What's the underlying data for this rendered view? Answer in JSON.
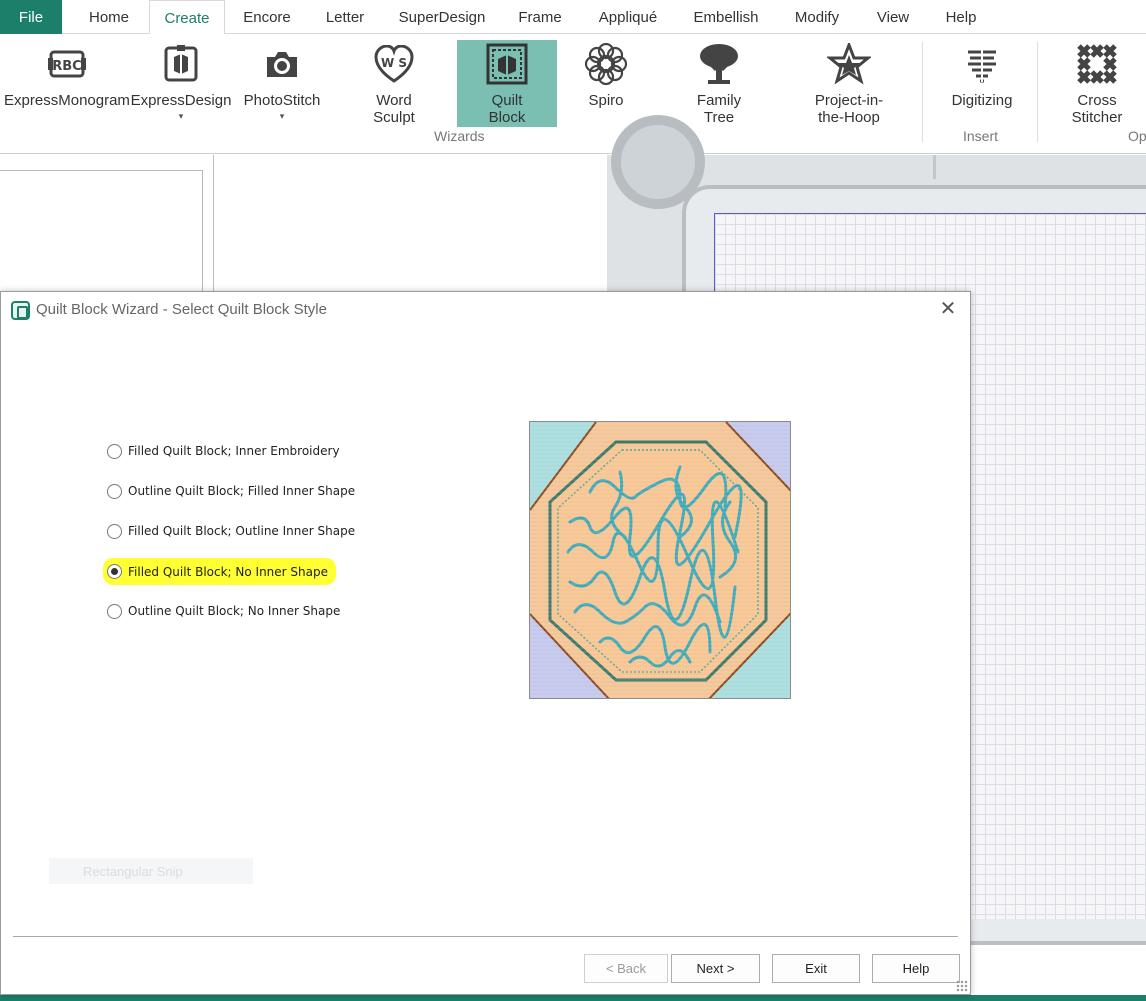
{
  "menubar": {
    "file": "File",
    "tabs": [
      "Home",
      "Create",
      "Encore",
      "Letter",
      "SuperDesign",
      "Frame",
      "Appliqué",
      "Embellish",
      "Modify",
      "View",
      "Help"
    ],
    "active_tab": "Create"
  },
  "ribbon": {
    "buttons": {
      "express_monogram": "ExpressMonogram",
      "express_design": "ExpressDesign",
      "photostitch": "PhotoStitch",
      "word_sculpt_1": "Word",
      "word_sculpt_2": "Sculpt",
      "quilt_block_1": "Quilt",
      "quilt_block_2": "Block",
      "spiro": "Spiro",
      "family_tree_1": "Family",
      "family_tree_2": "Tree",
      "project_hoop_1": "Project-in-",
      "project_hoop_2": "the-Hoop",
      "digitizing": "Digitizing",
      "cross_stitcher_1": "Cross",
      "cross_stitcher_2": "Stitcher"
    },
    "dropdown_caret": "▾",
    "groups": {
      "wizards": "Wizards",
      "insert": "Insert",
      "other_partial": "Op"
    },
    "selected_button": "Quilt Block"
  },
  "dialog": {
    "title": "Quilt Block Wizard - Select Quilt Block Style",
    "close_glyph": "✕",
    "options": [
      "Filled Quilt Block; Inner Embroidery",
      "Outline Quilt Block; Filled Inner Shape",
      "Filled Quilt Block; Outline Inner Shape",
      "Filled Quilt Block; No Inner Shape",
      "Outline Quilt Block; No Inner Shape"
    ],
    "selected_option": "Filled Quilt Block; No Inner Shape",
    "ghost_overlay": "Rectangular Snip",
    "buttons": {
      "back": "< Back",
      "next": "Next >",
      "exit": "Exit",
      "help": "Help"
    }
  },
  "colors": {
    "accent": "#1b7f6a",
    "selected_ribbon": "#7bbfb3",
    "highlight": "#ffff33"
  },
  "icons": {
    "ribbon": [
      "monogram-icon",
      "express-design-icon",
      "camera-icon",
      "word-sculpt-icon",
      "quilt-block-icon",
      "spiro-icon",
      "tree-icon",
      "hoop-star-icon",
      "digitizing-icon",
      "cross-stitch-icon"
    ],
    "dialog": [
      "wizard-app-icon",
      "close-icon",
      "resize-grip-icon"
    ]
  }
}
